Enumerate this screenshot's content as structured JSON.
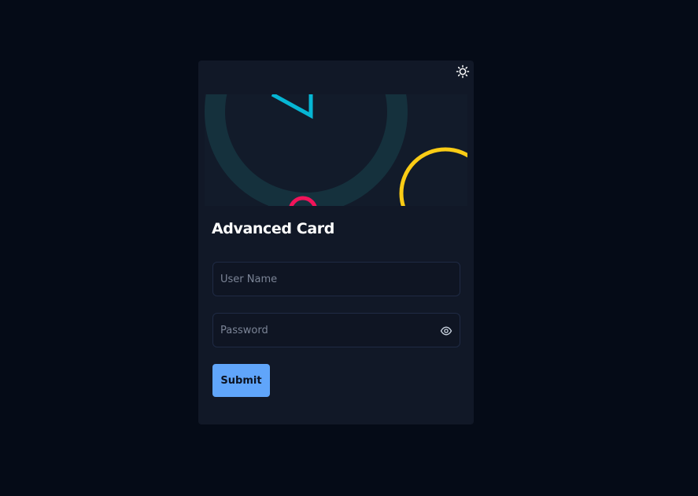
{
  "card": {
    "title": "Advanced Card",
    "theme_toggle_icon": "sun-icon"
  },
  "form": {
    "username": {
      "placeholder": "User Name",
      "value": ""
    },
    "password": {
      "placeholder": "Password",
      "value": "",
      "toggle_icon": "eye-icon"
    },
    "submit_label": "Submit"
  },
  "colors": {
    "page_background": "#050b17",
    "card_background": "#111827",
    "field_border": "#1f2a44",
    "button_background": "#60a5fa",
    "accent_cyan": "#06b6d4",
    "accent_yellow": "#facc15",
    "accent_pink": "#f0145a"
  }
}
